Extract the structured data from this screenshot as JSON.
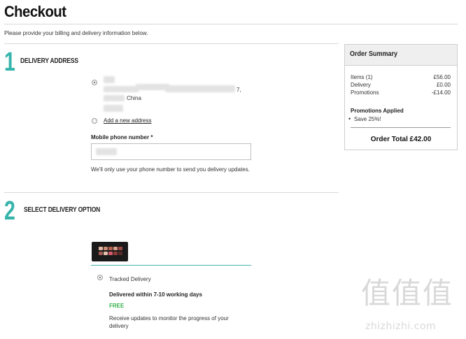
{
  "page": {
    "title": "Checkout",
    "intro": "Please provide your billing and delivery information below."
  },
  "steps": [
    {
      "number": "1",
      "title": "DELIVERY ADDRESS"
    },
    {
      "number": "2",
      "title": "SELECT DELIVERY OPTION"
    }
  ],
  "address": {
    "country_line": "China",
    "suffix": "7,",
    "add_new_label": "Add a new address"
  },
  "phone": {
    "label": "Mobile phone number *",
    "value": "",
    "helper": "We'll only use your phone number to send you delivery updates."
  },
  "summary": {
    "title": "Order Summary",
    "rows": [
      {
        "label": "Items (1)",
        "value": "£56.00"
      },
      {
        "label": "Delivery",
        "value": "£0.00"
      },
      {
        "label": "Promotions",
        "value": "-£14.00"
      }
    ],
    "promotions_heading": "Promotions Applied",
    "promotions": [
      "Save 25%!"
    ],
    "total": "Order Total £42.00"
  },
  "delivery": {
    "option_name": "Tracked Delivery",
    "timeframe": "Delivered within 7-10 working days",
    "price": "FREE",
    "note": "Receive updates to monitor the progress of your delivery"
  },
  "watermark": {
    "glyphs": "值值值",
    "site": "zhizhizhi.com"
  },
  "colors": {
    "accent_teal": "#36b4ab",
    "free_green": "#37b24d"
  }
}
